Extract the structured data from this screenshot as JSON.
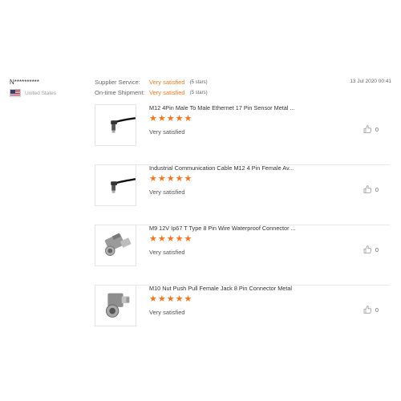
{
  "reviewer": {
    "name": "N**********",
    "country": "United States",
    "flag_icon": "us-flag-icon"
  },
  "date": "13 Jul 2020 00:41",
  "ratings": [
    {
      "label": "Supplier Service:",
      "value": "Very satisfied",
      "count": "(5 stars)"
    },
    {
      "label": "On-time Shipment:",
      "value": "Very satisfied",
      "count": "(5 stars)"
    }
  ],
  "colors": {
    "accent": "#e87c2a",
    "star": "#f47521",
    "divider": "#e8e8e8"
  },
  "products": [
    {
      "title": "M12 4Pin Male To Male Ethernet 17 Pin Sensor Metal ...",
      "stars": 5,
      "rating_text": "Very satisfied",
      "likes": "0",
      "image": "cable-right-angle-connector"
    },
    {
      "title": "Industrial Communication Cable M12 4 Pin Female Av...",
      "stars": 5,
      "rating_text": "Very satisfied",
      "likes": "0",
      "image": "cable-right-angle-connector"
    },
    {
      "title": "M9 12V Ip67 T Type 8 Pin Wire Waterproof Connector ...",
      "stars": 5,
      "rating_text": "Very satisfied",
      "likes": "0",
      "image": "metal-t-connector"
    },
    {
      "title": "M10 Nut Push Pull Female Jack 8 Pin Connector Metal",
      "stars": 5,
      "rating_text": "Very satisfied",
      "likes": "0",
      "image": "metal-angle-connector"
    }
  ]
}
